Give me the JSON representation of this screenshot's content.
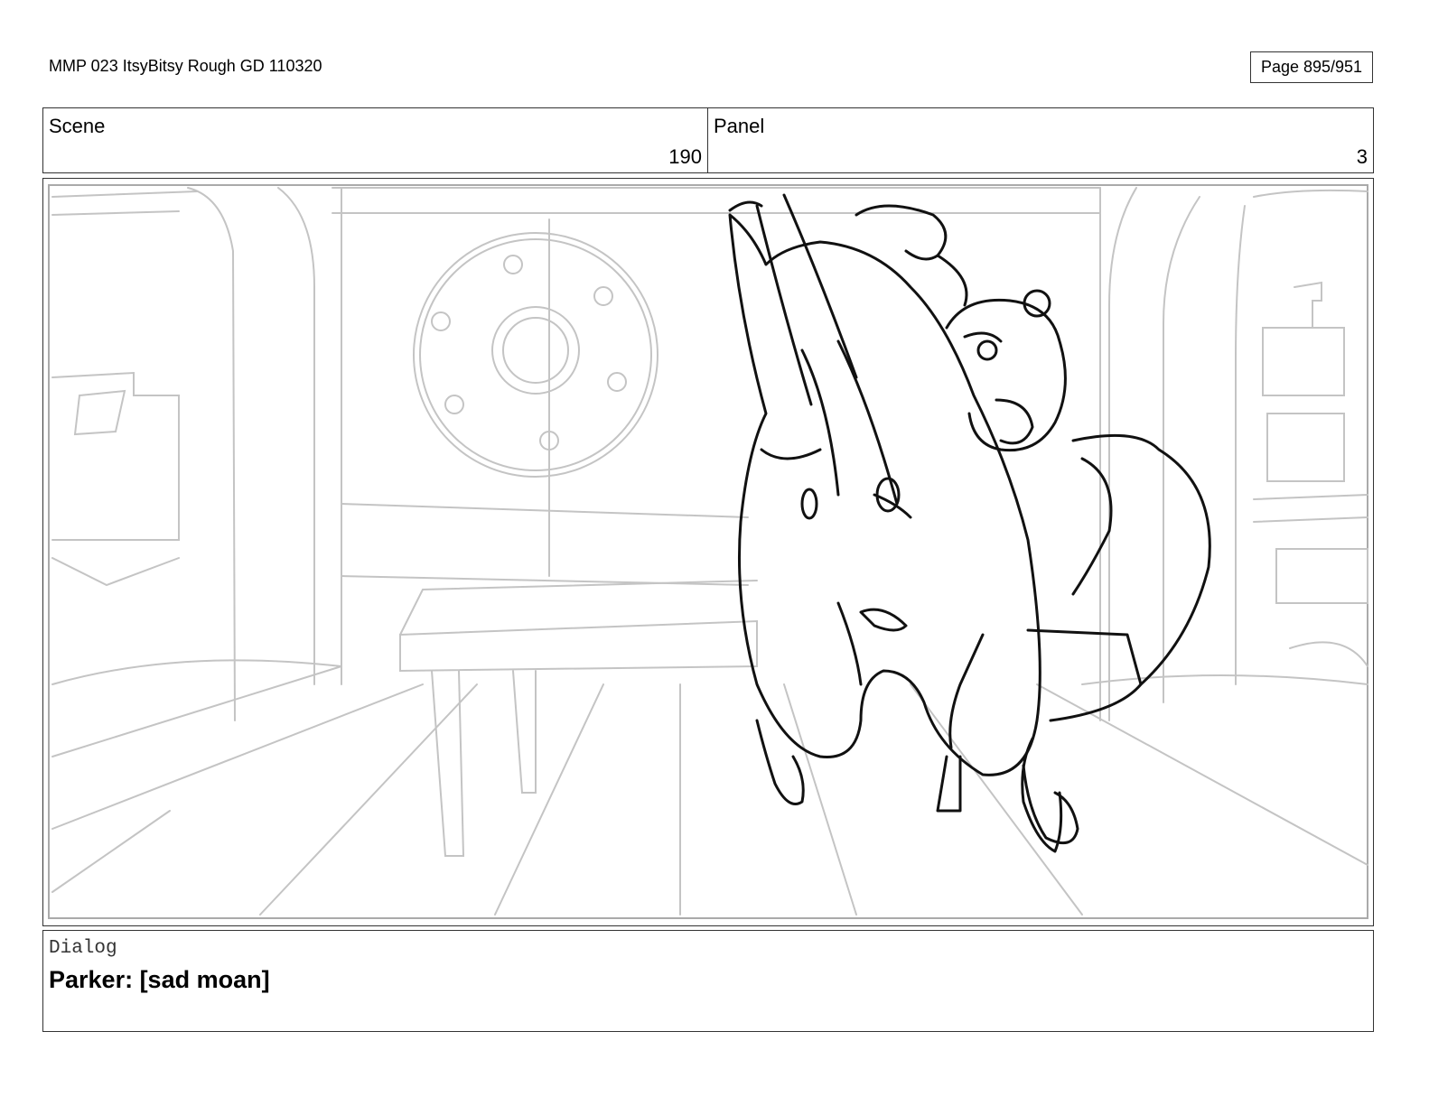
{
  "header": {
    "document_title": "MMP 023 ItsyBitsy Rough GD 110320",
    "page_label": "Page 895/951"
  },
  "info": {
    "scene_label": "Scene",
    "scene_value": "190",
    "panel_label": "Panel",
    "panel_value": "3"
  },
  "dialog": {
    "label": "Dialog",
    "text": "Parker: [sad moan]"
  }
}
